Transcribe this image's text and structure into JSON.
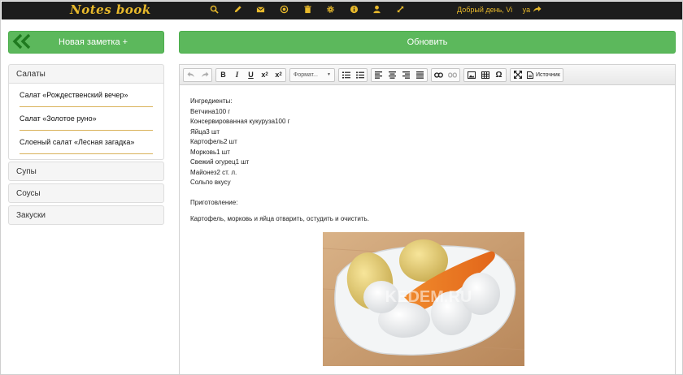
{
  "header": {
    "logo": "Notes book",
    "icons": [
      "search-icon",
      "pencil-icon",
      "envelope-icon",
      "record-icon",
      "trash-icon",
      "cog-icon",
      "info-icon",
      "user-icon",
      "resize-icon"
    ],
    "greeting": "Добрый день, Vi",
    "username": "ya"
  },
  "sidebar": {
    "new_note_label": "Новая заметка +",
    "categories": [
      {
        "label": "Салаты",
        "notes": [
          "Салат «Рождественский вечер»",
          "Салат «Золотое руно»",
          "Слоеный салат «Лесная загадка»"
        ]
      },
      {
        "label": "Супы"
      },
      {
        "label": "Соусы"
      },
      {
        "label": "Закуски"
      }
    ]
  },
  "main": {
    "refresh_label": "Обновить"
  },
  "editor": {
    "format_combo": "Формат...",
    "source_label": "Источник",
    "lines": [
      "Ингредиенты:",
      "Ветчина100 г",
      "Консервированная кукуруза100 г",
      "Яйца3 шт",
      "Картофель2 шт",
      "Морковь1 шт",
      "Свежий огурец1 шт",
      "Майонез2 ст. л.",
      "Сольпо вкусу",
      "Приготовление:",
      "Картофель, морковь и яйца отварить, остудить и очистить."
    ],
    "image_watermark": "KEDEM.RU"
  },
  "colors": {
    "topbar": "#1c1c1c",
    "accent": "#e8b92b",
    "green": "#5cb85c",
    "divider": "#d9b25a"
  }
}
